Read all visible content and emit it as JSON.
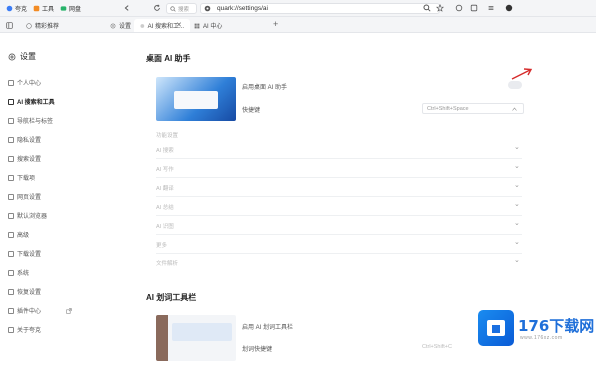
{
  "toolbar": {
    "items": [
      "夸克",
      "工具",
      "网盘"
    ],
    "url": "quark://settings/ai",
    "search_placeholder": "搜索"
  },
  "tabs": [
    {
      "label": "精彩推荐"
    },
    {
      "label": "设置"
    },
    {
      "label": "AI 搜索和工..."
    },
    {
      "label": "AI 中心"
    }
  ],
  "sidebar": {
    "title": "设置",
    "items": [
      {
        "label": "个人中心"
      },
      {
        "label": "AI 搜索和工具"
      },
      {
        "label": "导航栏与标签"
      },
      {
        "label": "隐私设置"
      },
      {
        "label": "搜索设置"
      },
      {
        "label": "下载项"
      },
      {
        "label": "网页设置"
      },
      {
        "label": "默认浏览器"
      },
      {
        "label": "高级"
      },
      {
        "label": "下载设置"
      },
      {
        "label": "系统"
      },
      {
        "label": "恢复设置"
      },
      {
        "label": "插件中心"
      },
      {
        "label": "关于夸克"
      }
    ]
  },
  "main": {
    "section1_title": "桌面 AI 助手",
    "desktop_ai_toggle_label": "启用桌面 AI 助手",
    "shortcut_label": "快捷键",
    "shortcut_value": "Ctrl+Shift+Space",
    "sub_header": "功能设置",
    "rows": [
      {
        "label": "AI 搜索"
      },
      {
        "label": "AI 写作"
      },
      {
        "label": "AI 翻译"
      },
      {
        "label": "AI 总结"
      },
      {
        "label": "AI 识图"
      },
      {
        "label": "更多"
      },
      {
        "label": "文件解析"
      }
    ],
    "section2_title": "AI 划词工具栏",
    "toolbar_toggle_label": "启用 AI 划词工具栏",
    "toolbar_shortcut_label": "划词快捷键",
    "toolbar_shortcut_value": "Ctrl+Shift+C"
  },
  "watermark": {
    "text": "176下载网",
    "sub": "www.176xz.com"
  }
}
